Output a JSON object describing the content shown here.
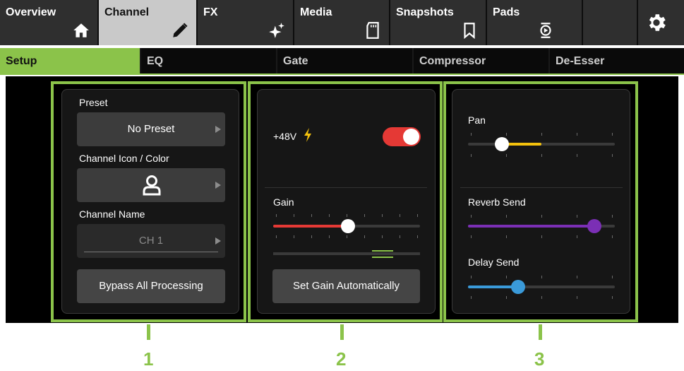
{
  "topnav": {
    "tabs": [
      {
        "label": "Overview",
        "icon": "home-icon"
      },
      {
        "label": "Channel",
        "icon": "pencil-icon",
        "active": true
      },
      {
        "label": "FX",
        "icon": "sparkle-icon"
      },
      {
        "label": "Media",
        "icon": "sd-card-icon"
      },
      {
        "label": "Snapshots",
        "icon": "bookmark-icon"
      },
      {
        "label": "Pads",
        "icon": "pads-icon"
      }
    ],
    "settings_icon": "gear-icon"
  },
  "subnav": {
    "tabs": [
      {
        "label": "Setup",
        "active": true
      },
      {
        "label": "EQ"
      },
      {
        "label": "Gate"
      },
      {
        "label": "Compressor"
      },
      {
        "label": "De-Esser"
      }
    ]
  },
  "panel1": {
    "preset_label": "Preset",
    "preset_value": "No Preset",
    "icon_color_label": "Channel Icon / Color",
    "channel_icon": "person-icon",
    "name_label": "Channel Name",
    "name_value": "CH 1",
    "bypass_button": "Bypass All Processing"
  },
  "panel2": {
    "phantom_label": "+48V",
    "phantom_on": true,
    "gain_label": "Gain",
    "gain_level": 0.51,
    "set_gain_button": "Set Gain Automatically"
  },
  "panel3": {
    "pan_label": "Pan",
    "pan_level": 0.23,
    "reverb_label": "Reverb Send",
    "reverb_level": 0.86,
    "delay_label": "Delay Send",
    "delay_level": 0.34
  },
  "callouts": [
    "1",
    "2",
    "3"
  ],
  "colors": {
    "accent_green": "#8bc34a",
    "toggle_red": "#e53935",
    "gain_red": "#e53935",
    "pan_yellow": "#f4c20d",
    "reverb_purple": "#7b2fb5",
    "delay_blue": "#3a9ad9"
  }
}
